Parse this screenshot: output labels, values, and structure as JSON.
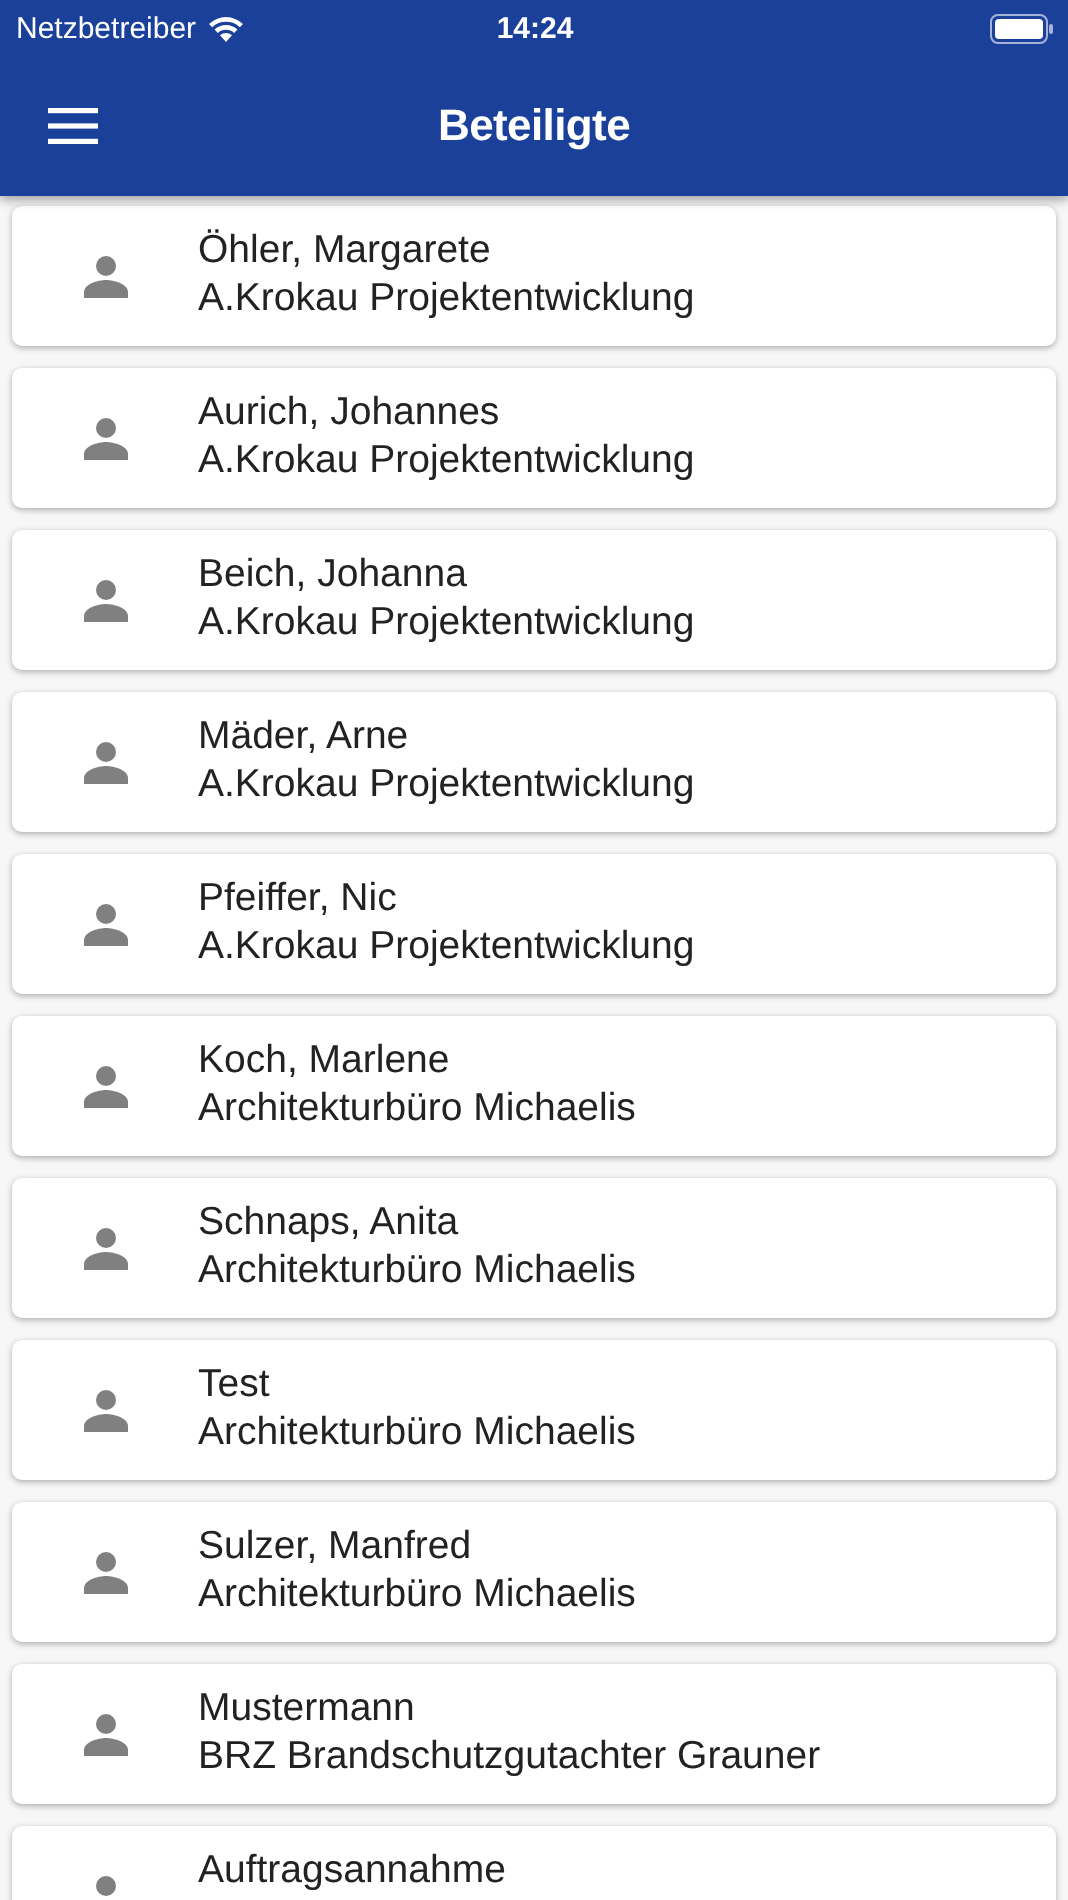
{
  "status_bar": {
    "carrier": "Netzbetreiber",
    "time": "14:24"
  },
  "header": {
    "title": "Beteiligte"
  },
  "participants": [
    {
      "name": "Öhler, Margarete",
      "company": "A.Krokau Projektentwicklung"
    },
    {
      "name": "Aurich, Johannes",
      "company": "A.Krokau Projektentwicklung"
    },
    {
      "name": "Beich, Johanna",
      "company": "A.Krokau Projektentwicklung"
    },
    {
      "name": "Mäder, Arne",
      "company": "A.Krokau Projektentwicklung"
    },
    {
      "name": "Pfeiffer, Nic",
      "company": "A.Krokau Projektentwicklung"
    },
    {
      "name": "Koch, Marlene",
      "company": "Architekturbüro Michaelis"
    },
    {
      "name": "Schnaps, Anita",
      "company": "Architekturbüro Michaelis"
    },
    {
      "name": "Test",
      "company": "Architekturbüro Michaelis"
    },
    {
      "name": "Sulzer, Manfred",
      "company": "Architekturbüro Michaelis"
    },
    {
      "name": "Mustermann",
      "company": "BRZ Brandschutzgutachter Grauner"
    },
    {
      "name": "Auftragsannahme"
    }
  ]
}
